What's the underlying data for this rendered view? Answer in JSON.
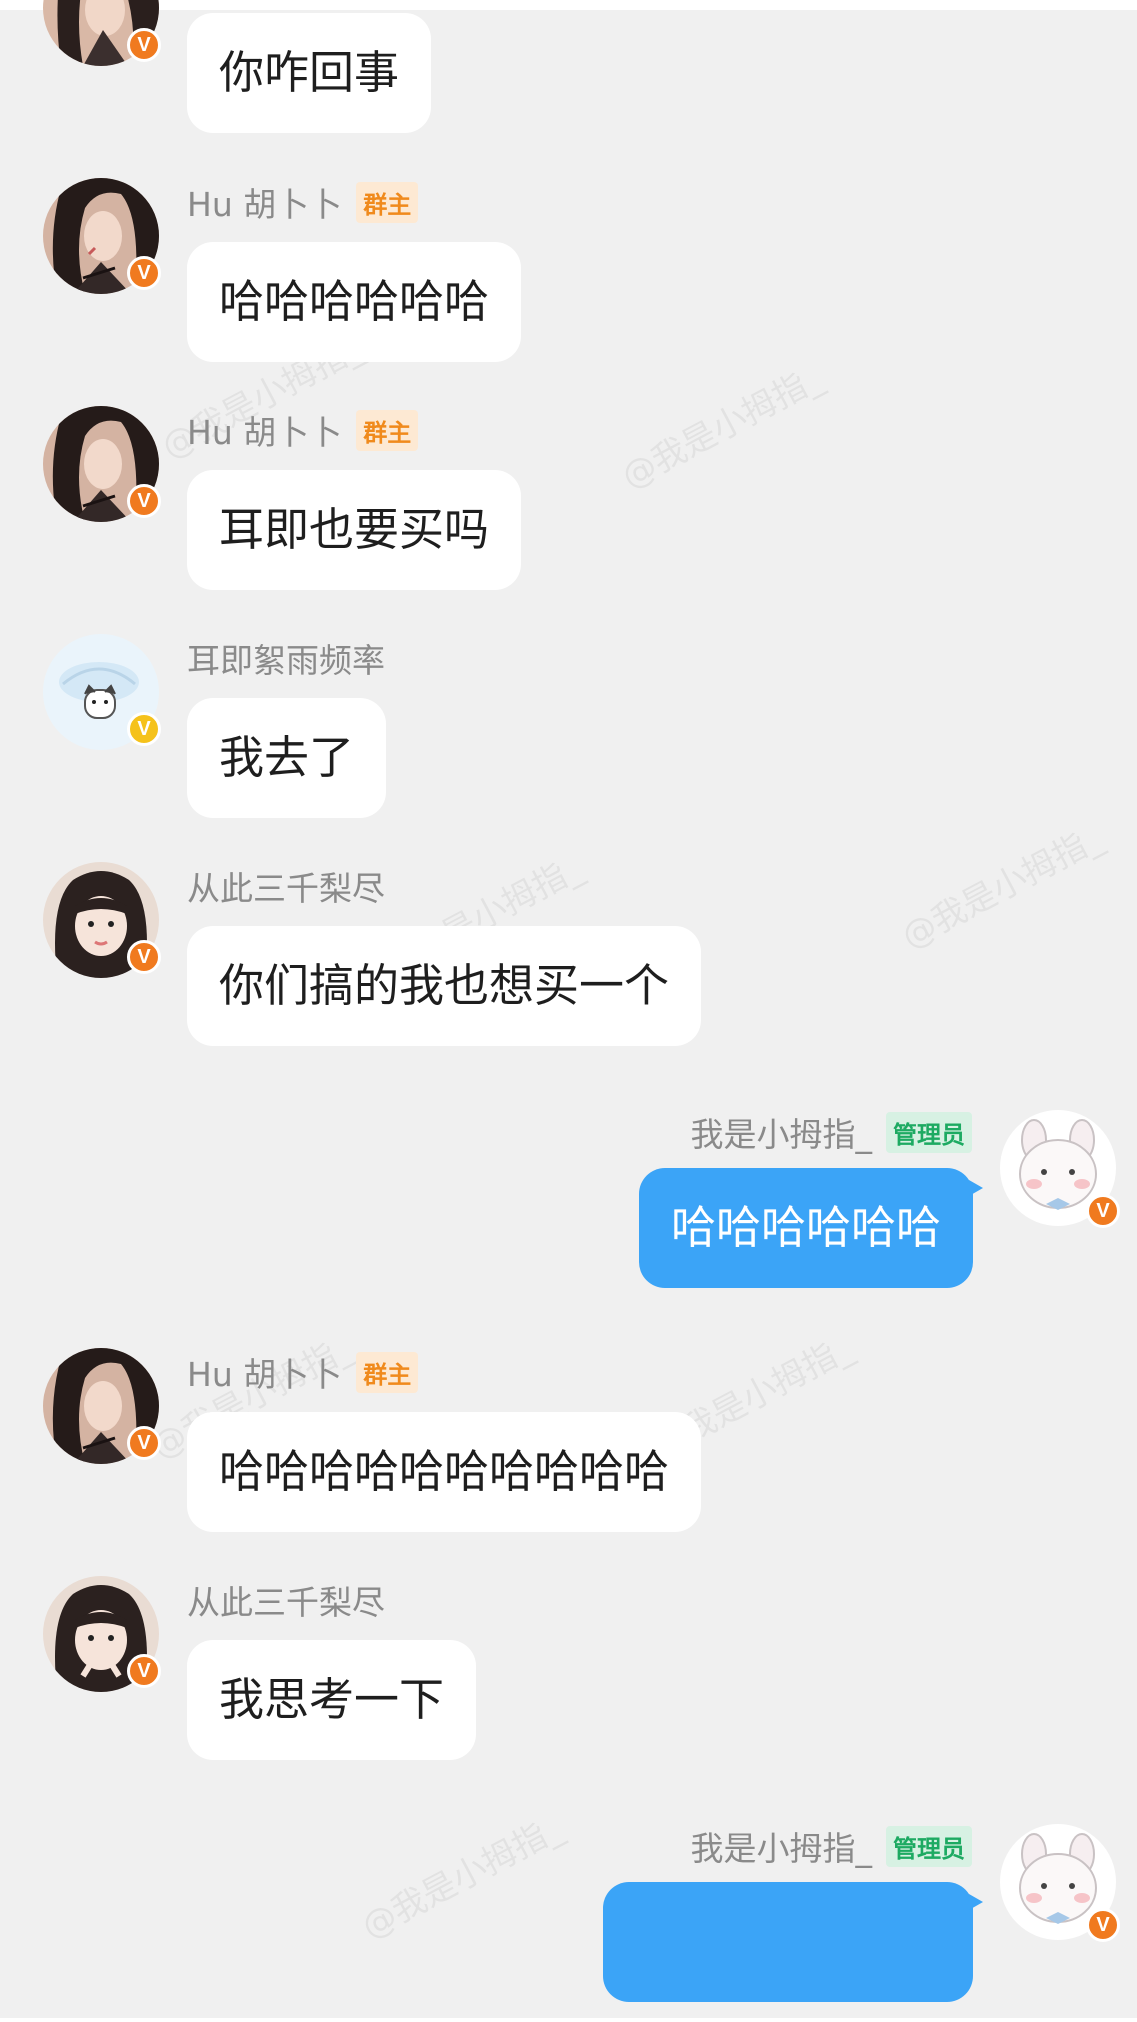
{
  "colors": {
    "background": "#f0f0f0",
    "bubble_other": "#ffffff",
    "bubble_mine": "#3ba4f7",
    "owner_tag": "#f08a1c",
    "admin_tag": "#1daa62",
    "v_badge_orange": "#f07a1f",
    "v_badge_yellow": "#f5c21b"
  },
  "watermark": "@我是小拇指_",
  "messages": [
    {
      "sender": "",
      "tag": "",
      "text": "你咋回事",
      "avatar": "girl-dark-hair-avatar",
      "badge": "V"
    },
    {
      "sender": "Hu 胡卜卜",
      "tag": "群主",
      "text": "哈哈哈哈哈哈",
      "avatar": "girl-dark-hair-avatar",
      "badge": "V"
    },
    {
      "sender": "Hu 胡卜卜",
      "tag": "群主",
      "text": "耳即也要买吗",
      "avatar": "girl-dark-hair-avatar",
      "badge": "V"
    },
    {
      "sender": "耳即絮雨频率",
      "tag": "",
      "text": "我去了",
      "avatar": "cat-umbrella-avatar",
      "badge": "V"
    },
    {
      "sender": "从此三千梨尽",
      "tag": "",
      "text": "你们搞的我也想买一个",
      "avatar": "girl-bangs-avatar",
      "badge": "V"
    },
    {
      "sender": "我是小拇指_",
      "tag": "管理员",
      "text": "哈哈哈哈哈哈",
      "avatar": "bunny-avatar",
      "badge": "V"
    },
    {
      "sender": "Hu 胡卜卜",
      "tag": "群主",
      "text": "哈哈哈哈哈哈哈哈哈哈",
      "avatar": "girl-dark-hair-avatar",
      "badge": "V"
    },
    {
      "sender": "从此三千梨尽",
      "tag": "",
      "text": "我思考一下",
      "avatar": "girl-bangs-avatar",
      "badge": "V"
    },
    {
      "sender": "我是小拇指_",
      "tag": "管理员",
      "text": "",
      "avatar": "bunny-avatar",
      "badge": "V"
    }
  ]
}
